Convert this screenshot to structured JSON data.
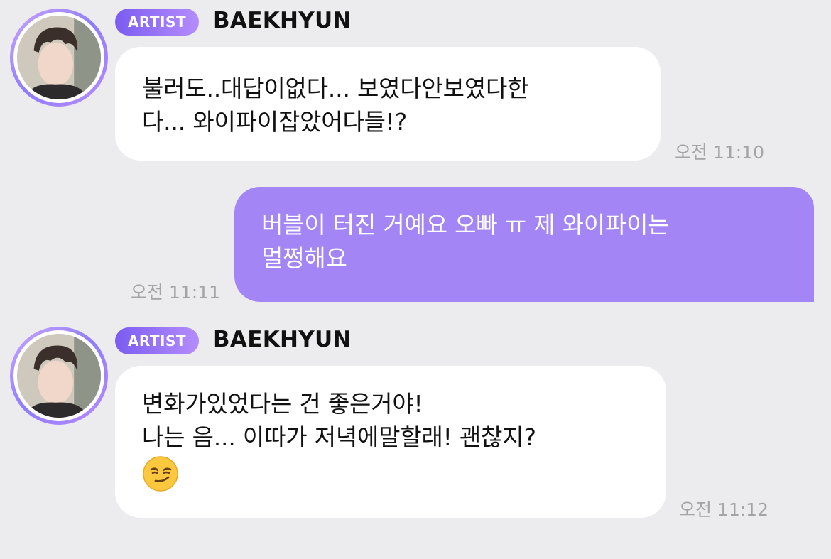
{
  "messages": [
    {
      "sender": "BAEKHYUN",
      "badge": "ARTIST",
      "lines": [
        "불러도..대답이없다... 보였다안보였다한",
        "다... 와이파이잡았어다들!?"
      ],
      "time": "오전 11:10"
    },
    {
      "sender": "me",
      "lines": [
        "버블이 터진 거예요 오빠 ㅠ 제 와이파이는",
        "멀쩡해요"
      ],
      "time": "오전 11:11"
    },
    {
      "sender": "BAEKHYUN",
      "badge": "ARTIST",
      "lines": [
        "변화가있었다는 건 좋은거야!",
        "나는 음... 이따가 저녁에말할래! 괜찮지?"
      ],
      "emoji": "smirking-face",
      "time": "오전 11:12"
    }
  ],
  "colors": {
    "background": "#ececee",
    "incoming_bubble": "#ffffff",
    "outgoing_bubble": "#a385f5",
    "badge_start": "#7b5cf0",
    "badge_end": "#b58cff",
    "timestamp": "#a3a3a8"
  }
}
